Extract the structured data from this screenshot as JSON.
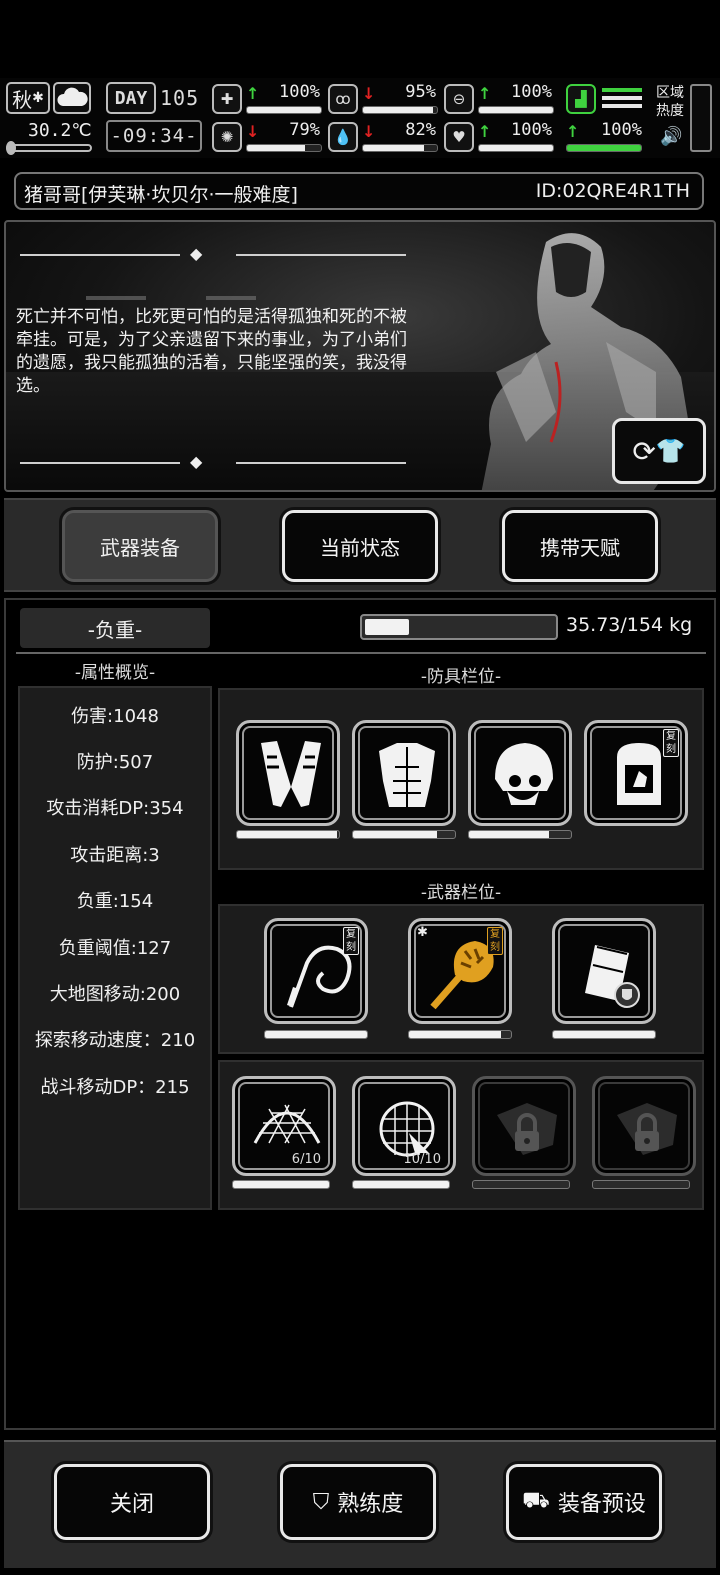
{
  "status": {
    "season": "秋",
    "temperature": "30.2℃",
    "day_label": "DAY",
    "day_number": "105",
    "time": "-09:34-",
    "zone_label": "区域热度",
    "stats": [
      {
        "icon": "medkit-icon",
        "trend": "up",
        "value": "100%",
        "fill": 1.0
      },
      {
        "icon": "stomach-icon",
        "trend": "down",
        "value": "95%",
        "fill": 0.95
      },
      {
        "icon": "capsule-icon",
        "trend": "up",
        "value": "100%",
        "fill": 1.0
      },
      {
        "icon": "brain-icon",
        "trend": "down",
        "value": "79%",
        "fill": 0.79
      },
      {
        "icon": "water-drop-icon",
        "trend": "down",
        "value": "82%",
        "fill": 0.82
      },
      {
        "icon": "heart-icon",
        "trend": "up",
        "value": "100%",
        "fill": 1.0
      },
      {
        "icon": "boot-icon",
        "trend": "up",
        "value": "100%",
        "fill": 1.0
      }
    ]
  },
  "character": {
    "name": "猪哥哥[伊芙琳·坎贝尔·一般难度]",
    "id": "ID:02QRE4R1TH",
    "quote": "死亡并不可怕，比死更可怕的是活得孤独和死的不被牵挂。可是，为了父亲遗留下来的事业，为了小弟们的遗愿，我只能孤独的活着，只能坚强的笑，我没得选。"
  },
  "tabs": [
    "武器装备",
    "当前状态",
    "携带天赋"
  ],
  "weight": {
    "label": "-负重-",
    "value": "35.73/154 kg",
    "fill": 0.232
  },
  "attributes": {
    "header": "-属性概览-",
    "items": [
      "伤害:1048",
      "防护:507",
      "攻击消耗DP:354",
      "攻击距离:3",
      "负重:154",
      "负重阈值:127",
      "大地图移动:200",
      "探索移动速度：210",
      "战斗移动DP：215"
    ]
  },
  "armor": {
    "header": "-防具栏位-",
    "slots": [
      {
        "name": "arm-guards",
        "durability": 0.98,
        "tag": ""
      },
      {
        "name": "chest-armor",
        "durability": 0.82,
        "tag": ""
      },
      {
        "name": "helmet",
        "durability": 0.78,
        "tag": ""
      },
      {
        "name": "backpack",
        "durability": 0,
        "tag": "复刻"
      }
    ]
  },
  "weapons": {
    "header": "-武器栏位-",
    "slots": [
      {
        "name": "whip",
        "durability": 1.0,
        "tag": "复刻",
        "gold": false
      },
      {
        "name": "golden-mace",
        "durability": 0.9,
        "tag": "复刻",
        "gold": true
      },
      {
        "name": "shield-case",
        "durability": 1.0,
        "tag": "",
        "gold": false
      }
    ]
  },
  "items": {
    "slots": [
      {
        "name": "net-trap",
        "count": "6/10",
        "durability": 1.0,
        "locked": false
      },
      {
        "name": "net-ball",
        "count": "10/10",
        "durability": 1.0,
        "locked": false
      },
      {
        "name": "locked-slot",
        "count": "",
        "durability": 0,
        "locked": true
      },
      {
        "name": "locked-slot",
        "count": "",
        "durability": 0,
        "locked": true
      }
    ]
  },
  "bottom": {
    "close": "关闭",
    "proficiency": "熟练度",
    "preset": "装备预设"
  },
  "colors": {
    "up": "#3fd23f",
    "down": "#e02222",
    "gold": "#e0a020"
  }
}
